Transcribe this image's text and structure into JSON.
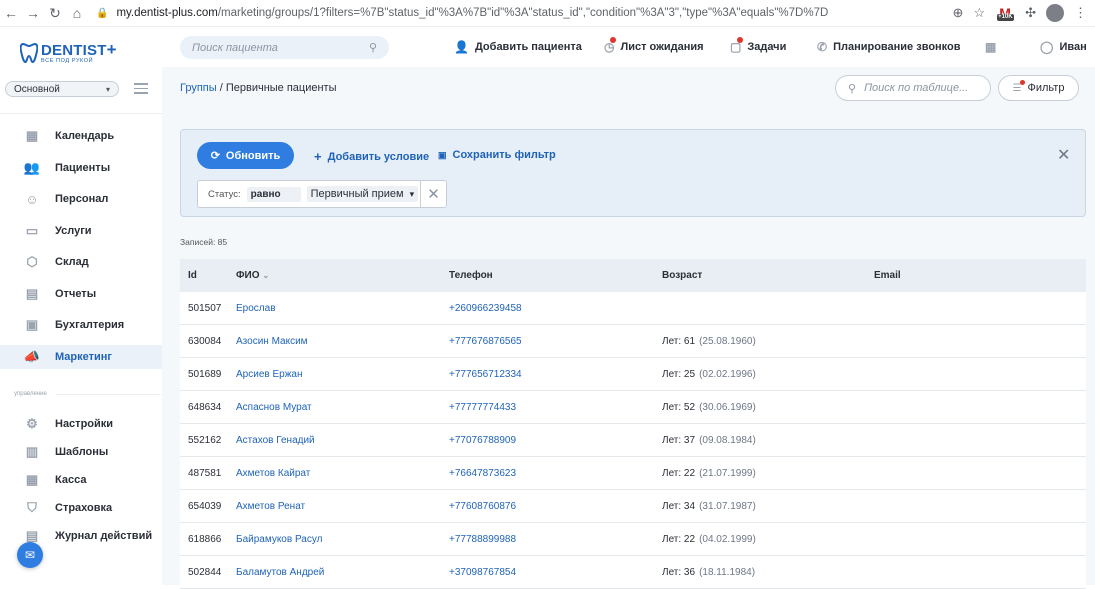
{
  "browser": {
    "url_host": "my.dentist-plus.com",
    "url_path": "/marketing/groups/1?filters=%7B\"status_id\"%3A%7B\"id\"%3A\"status_id\",\"condition\"%3A\"3\",\"type\"%3A\"equals\"%7D%7D",
    "gmail_badge": "+10K"
  },
  "header": {
    "brand_name": "DENTIST",
    "brand_plus": "+",
    "brand_tagline": "ВСЕ ПОД РУКОЙ",
    "search_placeholder": "Поиск пациента",
    "nav": {
      "add_patient": "Добавить пациента",
      "waiting_list": "Лист ожидания",
      "tasks": "Задачи",
      "call_planning": "Планирование звонков",
      "user": "Иван"
    }
  },
  "sidebar": {
    "branch": "Основной",
    "items": [
      {
        "label": "Календарь",
        "icon": "calendar-icon"
      },
      {
        "label": "Пациенты",
        "icon": "patients-icon"
      },
      {
        "label": "Персонал",
        "icon": "staff-icon"
      },
      {
        "label": "Услуги",
        "icon": "folder-icon"
      },
      {
        "label": "Склад",
        "icon": "warehouse-icon"
      },
      {
        "label": "Отчеты",
        "icon": "reports-icon"
      },
      {
        "label": "Бухгалтерия",
        "icon": "accounting-icon"
      },
      {
        "label": "Маркетинг",
        "icon": "megaphone-icon"
      }
    ],
    "group_label": "управление",
    "items2": [
      {
        "label": "Настройки",
        "icon": "settings-icon"
      },
      {
        "label": "Шаблоны",
        "icon": "templates-icon"
      },
      {
        "label": "Касса",
        "icon": "cash-icon"
      },
      {
        "label": "Страховка",
        "icon": "insurance-icon"
      },
      {
        "label": "Журнал действий",
        "icon": "log-icon"
      }
    ]
  },
  "main": {
    "breadcrumb_link": "Группы",
    "breadcrumb_sep": " / ",
    "breadcrumb_current": "Первичные пациенты",
    "table_search_placeholder": "Поиск по таблице...",
    "filter_label": "Фильтр",
    "filter_panel": {
      "refresh": "Обновить",
      "add_condition": "Добавить условие",
      "save_filter": "Сохранить фильтр",
      "condition_label": "Статус:",
      "condition_op": "равно",
      "condition_value": "Первичный прием"
    },
    "records": "Записей: 85",
    "columns": {
      "id": "Id",
      "name": "ФИО",
      "phone": "Телефон",
      "age": "Возраст",
      "email": "Email"
    },
    "rows": [
      {
        "id": "501507",
        "name": "Ерослав",
        "phone": "+260966239458",
        "age": "",
        "dob": "",
        "email": ""
      },
      {
        "id": "630084",
        "name": "Азосин Максим",
        "phone": "+777676876565",
        "age": "Лет: 61",
        "dob": "(25.08.1960)",
        "email": ""
      },
      {
        "id": "501689",
        "name": "Арсиев Ержан",
        "phone": "+777656712334",
        "age": "Лет: 25",
        "dob": "(02.02.1996)",
        "email": ""
      },
      {
        "id": "648634",
        "name": "Аспаснов Мурат",
        "phone": "+77777774433",
        "age": "Лет: 52",
        "dob": "(30.06.1969)",
        "email": ""
      },
      {
        "id": "552162",
        "name": "Астахов Генадий",
        "phone": "+77076788909",
        "age": "Лет: 37",
        "dob": "(09.08.1984)",
        "email": ""
      },
      {
        "id": "487581",
        "name": "Ахметов Кайрат",
        "phone": "+76647873623",
        "age": "Лет: 22",
        "dob": "(21.07.1999)",
        "email": ""
      },
      {
        "id": "654039",
        "name": "Ахметов Ренат",
        "phone": "+77608760876",
        "age": "Лет: 34",
        "dob": "(31.07.1987)",
        "email": ""
      },
      {
        "id": "618866",
        "name": "Байрамуков Расул",
        "phone": "+77788899988",
        "age": "Лет: 22",
        "dob": "(04.02.1999)",
        "email": ""
      },
      {
        "id": "502844",
        "name": "Баламутов Андрей",
        "phone": "+37098767854",
        "age": "Лет: 36",
        "dob": "(18.11.1984)",
        "email": ""
      }
    ]
  },
  "colors": {
    "accent": "#2f7de1",
    "link": "#1f63b8",
    "alert_dot": "#e0352b"
  }
}
